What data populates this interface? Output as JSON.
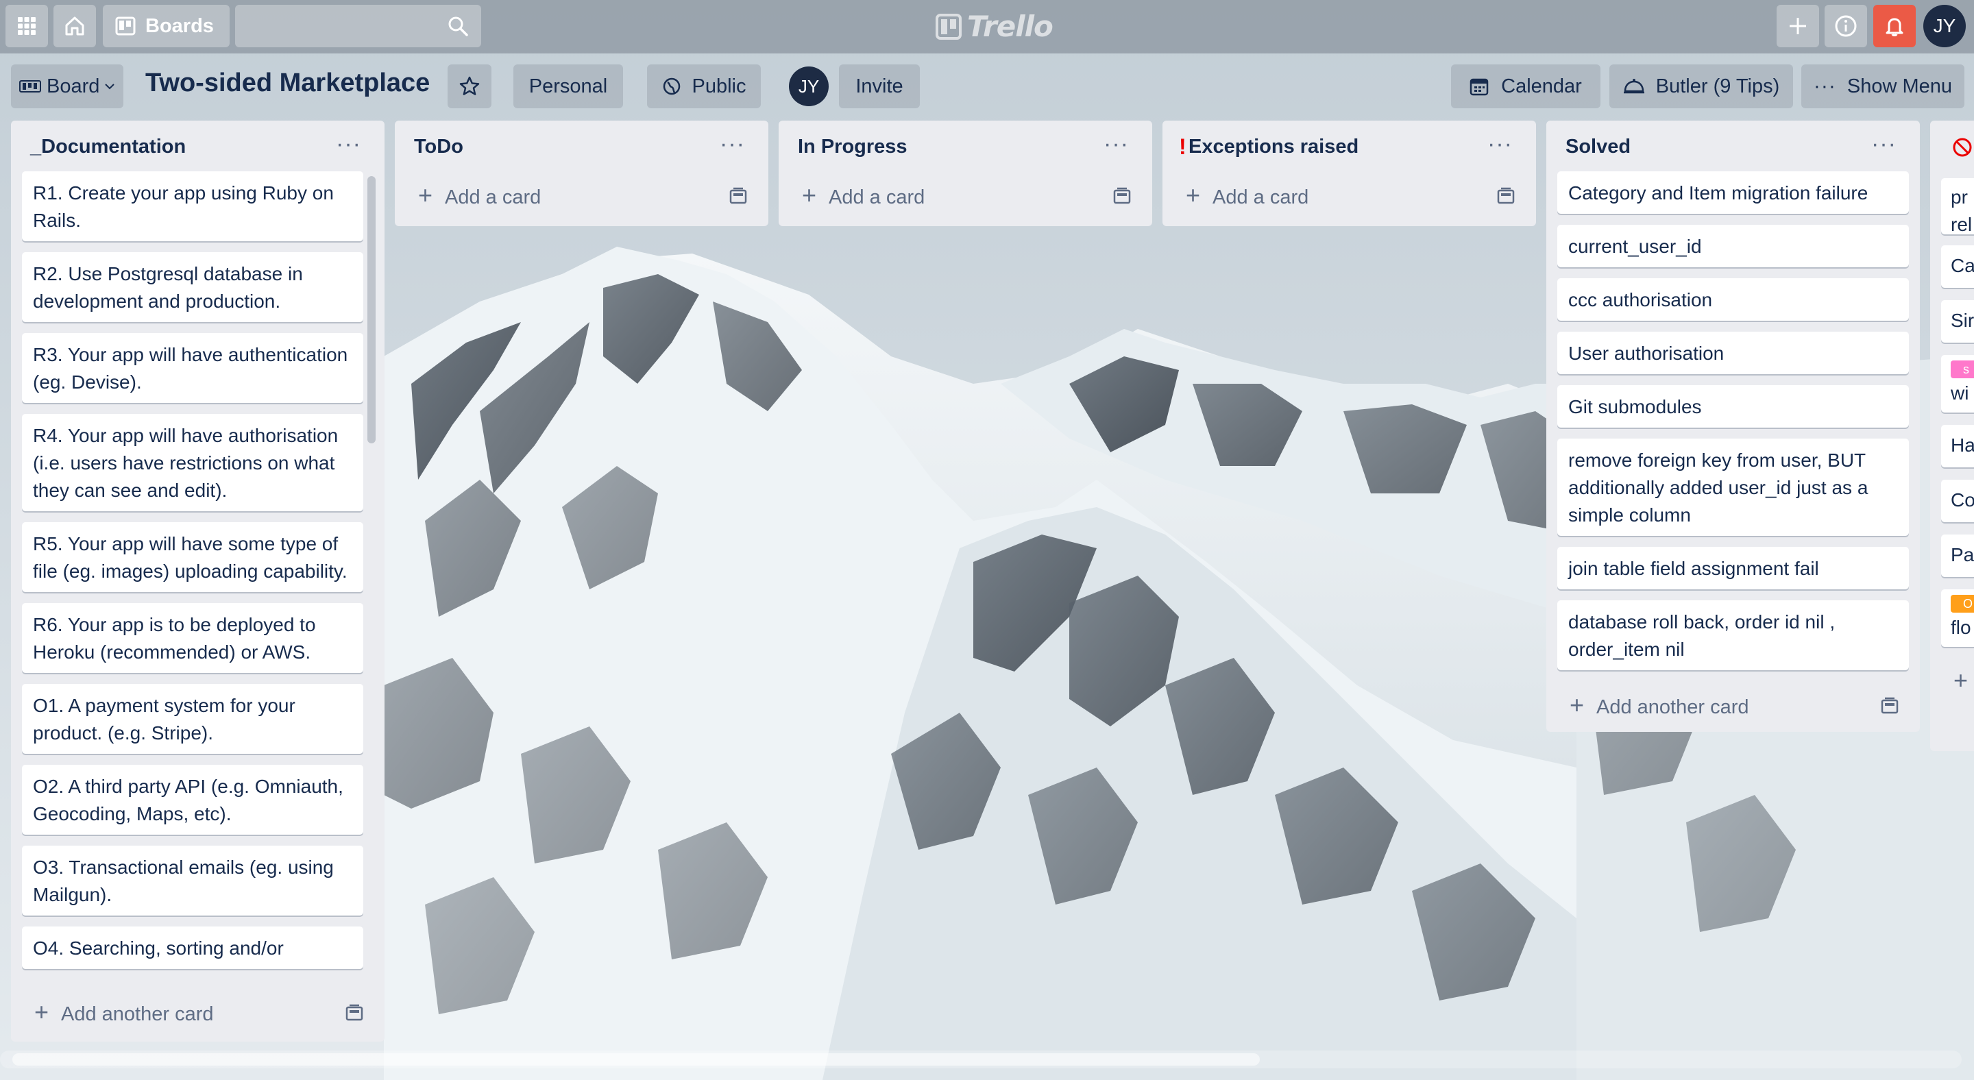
{
  "app": {
    "logo_text": "Trello",
    "boards_label": "Boards",
    "user_initials": "JY"
  },
  "board": {
    "view_label": "Board",
    "title": "Two-sided Marketplace",
    "team_label": "Personal",
    "visibility_label": "Public",
    "invite_label": "Invite",
    "calendar_label": "Calendar",
    "butler_label": "Butler (9 Tips)",
    "show_menu_label": "Show Menu",
    "member_initials": "JY"
  },
  "lists": [
    {
      "title": "_Documentation",
      "cards": [
        "R1. Create your app using Ruby on Rails.",
        "R2. Use Postgresql database in development and production.",
        "R3. Your app will have authentication (eg. Devise).",
        "R4. Your app will have authorisation (i.e. users have restrictions on what they can see and edit).",
        "R5. Your app will have some type of file (eg. images) uploading capability.",
        "R6. Your app is to be deployed to Heroku (recommended) or AWS.",
        "O1. A payment system for your product. (e.g. Stripe).",
        "O2. A third party API (e.g. Omniauth, Geocoding, Maps, etc).",
        "O3. Transactional emails (eg. using Mailgun).",
        "O4. Searching, sorting and/or"
      ],
      "add_label": "Add another card"
    },
    {
      "title": "ToDo",
      "cards": [],
      "add_label": "Add a card"
    },
    {
      "title": "In Progress",
      "cards": [],
      "add_label": "Add a card"
    },
    {
      "title": "Exceptions raised",
      "title_prefix": "!",
      "cards": [],
      "add_label": "Add a card"
    },
    {
      "title": "Solved",
      "cards": [
        "Category and Item migration failure",
        "current_user_id",
        "ccc authorisation",
        "User authorisation",
        "Git submodules",
        "remove foreign key from user, BUT additionally added user_id just as a simple column",
        "join table field assignment fail",
        "database roll back, order id nil , order_item nil"
      ],
      "add_label": "Add another card"
    }
  ],
  "partial_list": {
    "fragments": [
      "pr",
      "rel",
      "Ca",
      "Sir",
      "s",
      "wi",
      "Ha",
      "Co",
      "Pa",
      "O",
      "flo",
      "+"
    ],
    "label_colors": [
      "#ff78cb",
      "#ff9f1a"
    ]
  },
  "colors": {
    "notification_red": "#eb5a46",
    "exception_mark": "#eb0000",
    "avatar_bg": "#1d2b44"
  }
}
